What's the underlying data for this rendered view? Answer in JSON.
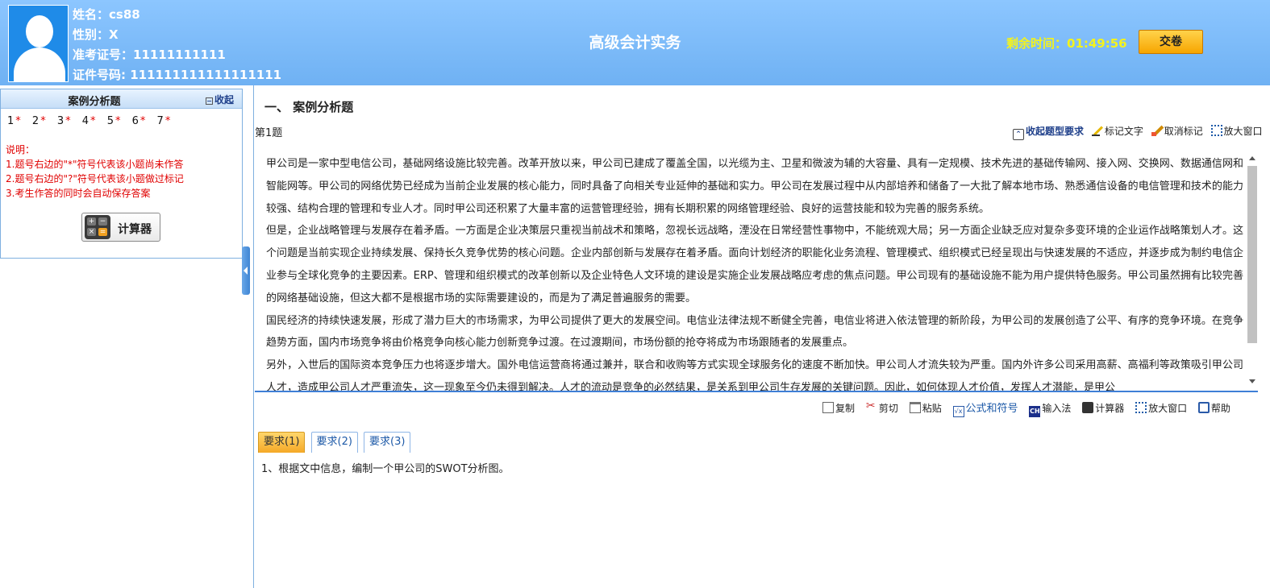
{
  "header": {
    "name_label": "姓名：cs88",
    "gender_label": "性别：X",
    "exam_id_label": "准考证号：11111111111",
    "cert_label": "证件号码: 111111111111111111",
    "title": "高级会计实务",
    "timer_label": "剩余时间：01:49:56",
    "submit_label": "交卷"
  },
  "sidebar": {
    "title": "案例分析题",
    "collapse_label": "收起",
    "question_numbers": [
      "1",
      "2",
      "3",
      "4",
      "5",
      "6",
      "7"
    ],
    "star": "*",
    "notes": [
      "说明：",
      "1.题号右边的\"*\"符号代表该小题尚未作答",
      "2.题号右边的\"?\"符号代表该小题做过标记",
      "3.考生作答的同时会自动保存答案"
    ],
    "calculator_label": "计算器"
  },
  "main": {
    "section_title": "一、 案例分析题",
    "question_label": "第1题",
    "top_tools": {
      "collapse_requirements": "收起题型要求",
      "mark_text": "标记文字",
      "cancel_mark": "取消标记",
      "enlarge": "放大窗口"
    },
    "passage": [
      "甲公司是一家中型电信公司，基础网络设施比较完善。改革开放以来，甲公司已建成了覆盖全国，以光缆为主、卫星和微波为辅的大容量、具有一定规模、技术先进的基础传输网、接入网、交换网、数据通信网和智能网等。甲公司的网络优势已经成为当前企业发展的核心能力，同时具备了向相关专业延伸的基础和实力。甲公司在发展过程中从内部培养和储备了一大批了解本地市场、熟悉通信设备的电信管理和技术的能力较强、结构合理的管理和专业人才。同时甲公司还积累了大量丰富的运营管理经验，拥有长期积累的网络管理经验、良好的运营技能和较为完善的服务系统。",
      "但是，企业战略管理与发展存在着矛盾。一方面是企业决策层只重视当前战术和策略，忽视长远战略，湮没在日常经营性事物中，不能统观大局；另一方面企业缺乏应对复杂多变环境的企业运作战略策划人才。这个问题是当前实现企业持续发展、保持长久竞争优势的核心问题。企业内部创新与发展存在着矛盾。面向计划经济的职能化业务流程、管理模式、组织模式已经呈现出与快速发展的不适应，并逐步成为制约电信企业参与全球化竞争的主要因素。ERP、管理和组织模式的改革创新以及企业特色人文环境的建设是实施企业发展战略应考虑的焦点问题。甲公司现有的基础设施不能为用户提供特色服务。甲公司虽然拥有比较完善的网络基础设施，但这大都不是根据市场的实际需要建设的，而是为了满足普遍服务的需要。",
      "国民经济的持续快速发展，形成了潜力巨大的市场需求，为甲公司提供了更大的发展空间。电信业法律法规不断健全完善，电信业将进入依法管理的新阶段，为甲公司的发展创造了公平、有序的竞争环境。在竞争趋势方面，国内市场竞争将由价格竞争向核心能力创新竞争过渡。在过渡期间，市场份额的抢夺将成为市场跟随者的发展重点。",
      "另外，入世后的国际资本竞争压力也将逐步增大。国外电信运营商将通过兼并，联合和收购等方式实现全球服务化的速度不断加快。甲公司人才流失较为严重。国内外许多公司采用高薪、高福利等政策吸引甲公司人才，造成甲公司人才严重流失，这一现象至今仍未得到解决。人才的流动是竞争的必然结果，是关系到甲公司生存发展的关键问题。因此，如何体现人才价值，发挥人才潜能，是甲公"
    ],
    "bottom_tools": {
      "copy": "复制",
      "cut": "剪切",
      "paste": "粘贴",
      "formula": "公式和符号",
      "ime": "输入法",
      "calculator": "计算器",
      "enlarge": "放大窗口",
      "help": "帮助"
    },
    "tabs": [
      "要求(1)",
      "要求(2)",
      "要求(3)"
    ],
    "active_tab": 0,
    "requirement_text": "1、根据文中信息，编制一个甲公司的SWOT分析图。"
  },
  "colors": {
    "header_bg": "#7ab9f7",
    "timer": "#f4f31c",
    "submit": "#f7a500",
    "note_red": "#e00000",
    "link_blue": "#1e3f8a"
  }
}
